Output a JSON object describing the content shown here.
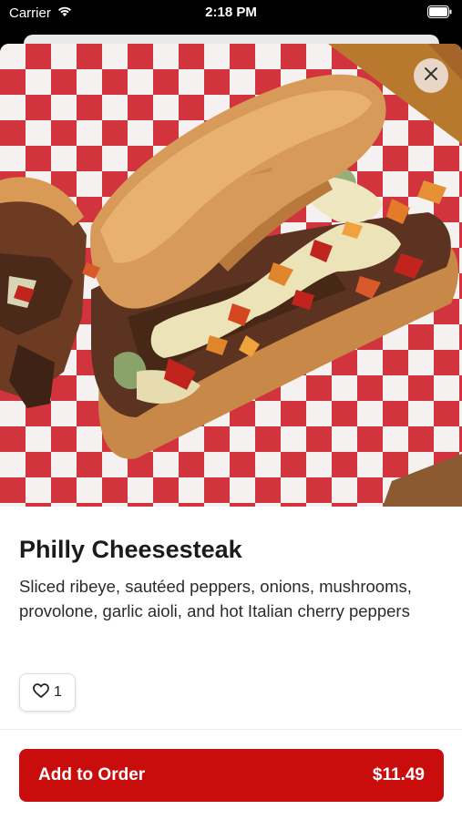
{
  "status_bar": {
    "carrier": "Carrier",
    "time": "2:18 PM",
    "icons": [
      "wifi-icon",
      "battery-icon"
    ]
  },
  "item": {
    "image_alt": "Philly Cheesesteak",
    "title": "Philly Cheesesteak",
    "description": "Sliced ribeye, sautéed peppers, onions, mushrooms, provolone, garlic aioli, and hot Italian cherry peppers",
    "likes": "1"
  },
  "actions": {
    "close_icon": "close-icon",
    "like_icon": "heart-icon",
    "add_label": "Add to Order",
    "price": "$11.49"
  },
  "colors": {
    "accent": "#c90d0d",
    "checker_red": "#d2343d"
  }
}
